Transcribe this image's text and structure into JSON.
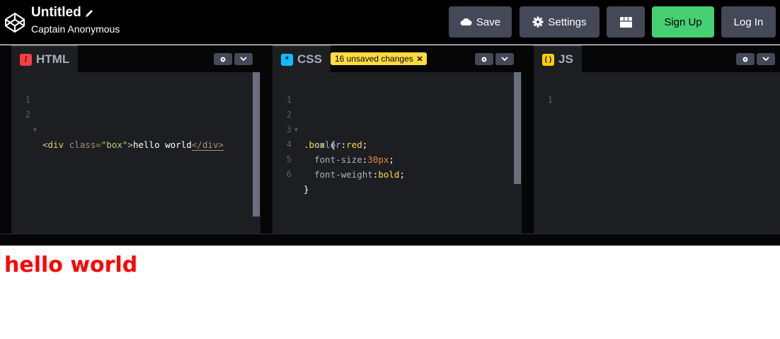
{
  "header": {
    "title": "Untitled",
    "author": "Captain Anonymous",
    "save_label": "Save",
    "settings_label": "Settings",
    "signup_label": "Sign Up",
    "login_label": "Log In"
  },
  "editors": {
    "html": {
      "tab": "HTML",
      "lines": [
        {
          "n": "1"
        },
        {
          "n": "2",
          "tag_open": "<div ",
          "attr": "class=",
          "str": "\"box\"",
          "tag_close": ">",
          "text": "hello world",
          "end_tag": "</div>"
        }
      ]
    },
    "css": {
      "tab": "CSS",
      "badge": "16 unsaved changes",
      "lines": [
        {
          "n": "1"
        },
        {
          "n": "2",
          "selector": ".box",
          "brace": " {"
        },
        {
          "n": "3",
          "prop": "color",
          "value": "red"
        },
        {
          "n": "4",
          "prop": "font-size",
          "value": "30px"
        },
        {
          "n": "5",
          "prop": "font-weight",
          "value": "bold"
        },
        {
          "n": "6",
          "brace": "}"
        }
      ]
    },
    "js": {
      "tab": "JS",
      "lines": [
        {
          "n": "1"
        }
      ]
    }
  },
  "preview": {
    "text": "hello world"
  },
  "colors": {
    "accent_green": "#47cf73",
    "badge_yellow": "#ffdd40",
    "html_icon": "#ff3c41",
    "css_icon": "#0ebeff",
    "js_icon": "#fcd000"
  }
}
